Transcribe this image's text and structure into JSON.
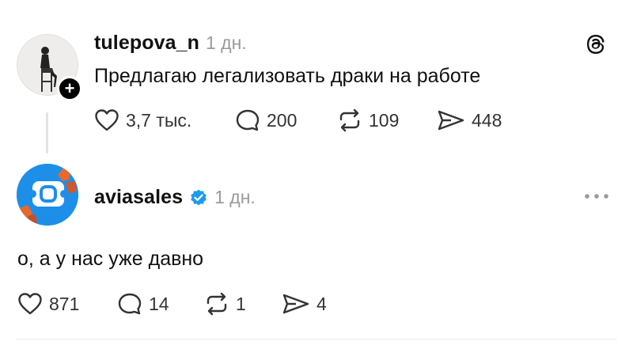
{
  "post1": {
    "username": "tulepova_n",
    "time": "1 дн.",
    "text": "Предлагаю легализовать драки на работе",
    "likes": "3,7 тыс.",
    "comments": "200",
    "reposts": "109",
    "shares": "448"
  },
  "post2": {
    "username": "aviasales",
    "time": "1 дн.",
    "text": "о, а у нас уже давно",
    "likes": "871",
    "comments": "14",
    "reposts": "1",
    "shares": "4"
  },
  "colors": {
    "verified": "#1d9bf0",
    "aviasales_blue": "#1e8fe8",
    "muted": "#9a9a9a"
  },
  "icons": [
    "threads-logo-icon",
    "heart-icon",
    "comment-icon",
    "repost-icon",
    "share-icon",
    "verified-icon",
    "more-icon",
    "plus-icon"
  ]
}
